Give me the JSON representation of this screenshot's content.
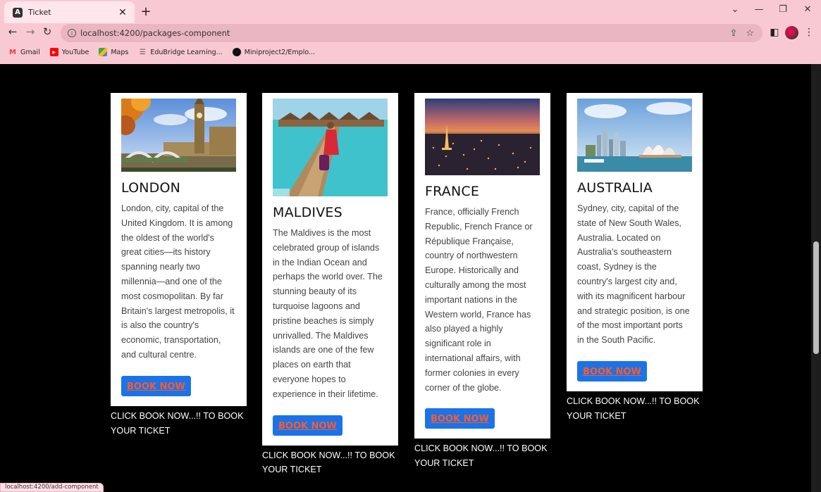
{
  "browser": {
    "tab_title": "Ticket",
    "tab_favicon": "A",
    "url": "localhost:4200/packages-component",
    "bookmarks": [
      {
        "label": "Gmail",
        "icon": "gmail-icon",
        "color": "#ea4335"
      },
      {
        "label": "YouTube",
        "icon": "youtube-icon",
        "color": "#ff0000"
      },
      {
        "label": "Maps",
        "icon": "maps-icon",
        "color": "#34a853"
      },
      {
        "label": "EduBridge Learning...",
        "icon": "edubridge-icon",
        "color": "#555555"
      },
      {
        "label": "Miniproject2/Emplo...",
        "icon": "github-icon",
        "color": "#111111"
      }
    ]
  },
  "page": {
    "cards": [
      {
        "title": "LONDON",
        "image": "london-image",
        "description": "London, city, capital of the United Kingdom. It is among the oldest of the world's great cities—its history spanning nearly two millennia—and one of the most cosmopolitan. By far Britain's largest metropolis, it is also the country's economic, transportation, and cultural centre.",
        "button_label": "BOOK NOW",
        "note": "CLICK BOOK NOW...!! TO BOOK YOUR TICKET"
      },
      {
        "title": "MALDIVES",
        "image": "maldives-image",
        "description": "The Maldives is the most celebrated group of islands in the Indian Ocean and perhaps the world over. The stunning beauty of its turquoise lagoons and pristine beaches is simply unrivalled. The Maldives islands are one of the few places on earth that everyone hopes to experience in their lifetime.",
        "button_label": "BOOK NOW",
        "note": "CLICK BOOK NOW...!! TO BOOK YOUR TICKET"
      },
      {
        "title": "FRANCE",
        "image": "france-image",
        "description": "France, officially French Republic, French France or République Française, country of northwestern Europe. Historically and culturally among the most important nations in the Western world, France has also played a highly significant role in international affairs, with former colonies in every corner of the globe.",
        "button_label": "BOOK NOW",
        "note": "CLICK BOOK NOW...!! TO BOOK YOUR TICKET"
      },
      {
        "title": "AUSTRALIA",
        "image": "australia-image",
        "description": "Sydney, city, capital of the state of New South Wales, Australia. Located on Australia's southeastern coast, Sydney is the country's largest city and, with its magnificent harbour and strategic position, is one of the most important ports in the South Pacific.",
        "button_label": "BOOK NOW",
        "note": "CLICK BOOK NOW...!! TO BOOK YOUR TICKET"
      }
    ]
  },
  "status_bar": {
    "link_preview": "localhost:4200/add-component"
  },
  "colors": {
    "chrome": "#f9c9d3",
    "button_bg": "#1a73e8",
    "button_text": "#ff5a2a",
    "page_bg": "#000000"
  }
}
